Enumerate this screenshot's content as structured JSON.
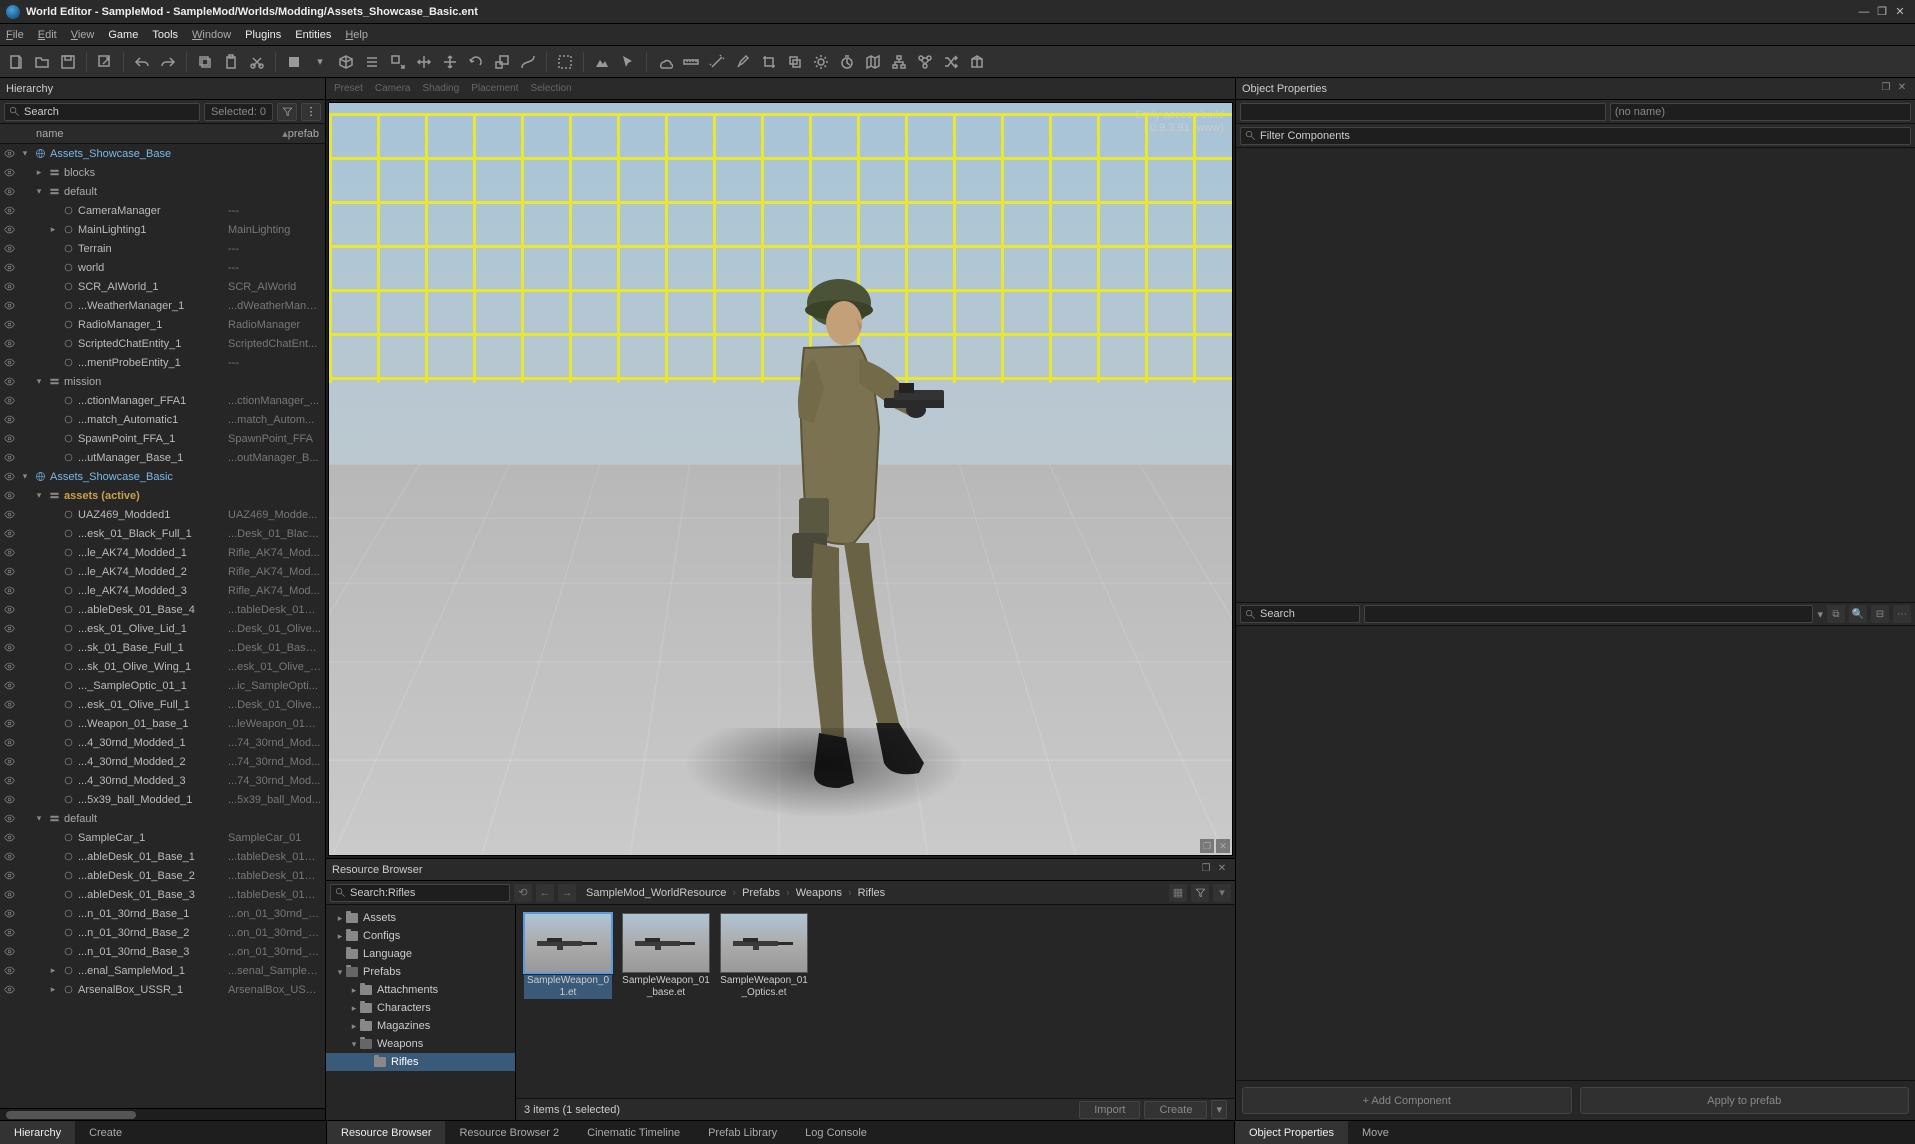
{
  "title": "World Editor - SampleMod - SampleMod/Worlds/Modding/Assets_Showcase_Basic.ent",
  "menus": [
    "File",
    "Edit",
    "View",
    "Game",
    "Tools",
    "Window",
    "Plugins",
    "Entities",
    "Help"
  ],
  "vp_tabs": [
    "Preset",
    "Camera",
    "Shading",
    "Placement",
    "Selection"
  ],
  "watermark": {
    "l1": "Early access build",
    "l2": "0.9.3.91 (www)"
  },
  "hierarchy": {
    "title": "Hierarchy",
    "search_ph": "Search",
    "selected": "Selected: 0",
    "head_name": "name",
    "head_prefab": "prefab",
    "tabs": [
      "Hierarchy",
      "Create"
    ],
    "rows": [
      {
        "d": 0,
        "tw": "▾",
        "ico": "world",
        "nm": "Assets_Showcase_Base",
        "pf": "",
        "hl": 1
      },
      {
        "d": 1,
        "tw": "▸",
        "ico": "layer",
        "nm": "blocks",
        "pf": "",
        "grp": 1
      },
      {
        "d": 1,
        "tw": "▾",
        "ico": "layer",
        "nm": "default",
        "pf": "",
        "grp": 1
      },
      {
        "d": 2,
        "tw": "",
        "ico": "ent",
        "nm": "CameraManager",
        "pf": "---"
      },
      {
        "d": 2,
        "tw": "▸",
        "ico": "ent",
        "nm": "MainLighting1",
        "pf": "MainLighting"
      },
      {
        "d": 2,
        "tw": "",
        "ico": "ent",
        "nm": "Terrain",
        "pf": "---"
      },
      {
        "d": 2,
        "tw": "",
        "ico": "ent",
        "nm": "world",
        "pf": "---"
      },
      {
        "d": 2,
        "tw": "",
        "ico": "ent",
        "nm": "SCR_AIWorld_1",
        "pf": "SCR_AIWorld"
      },
      {
        "d": 2,
        "tw": "",
        "ico": "ent",
        "nm": "...WeatherManager_1",
        "pf": "...dWeatherMana..."
      },
      {
        "d": 2,
        "tw": "",
        "ico": "ent",
        "nm": "RadioManager_1",
        "pf": "RadioManager"
      },
      {
        "d": 2,
        "tw": "",
        "ico": "ent",
        "nm": "ScriptedChatEntity_1",
        "pf": "ScriptedChatEnt..."
      },
      {
        "d": 2,
        "tw": "",
        "ico": "ent",
        "nm": "...mentProbeEntity_1",
        "pf": "---"
      },
      {
        "d": 1,
        "tw": "▾",
        "ico": "layer",
        "nm": "mission",
        "pf": "",
        "grp": 1
      },
      {
        "d": 2,
        "tw": "",
        "ico": "ent",
        "nm": "...ctionManager_FFA1",
        "pf": "...ctionManager_..."
      },
      {
        "d": 2,
        "tw": "",
        "ico": "ent",
        "nm": "...match_Automatic1",
        "pf": "...match_Autom..."
      },
      {
        "d": 2,
        "tw": "",
        "ico": "ent",
        "nm": "SpawnPoint_FFA_1",
        "pf": "SpawnPoint_FFA"
      },
      {
        "d": 2,
        "tw": "",
        "ico": "ent",
        "nm": "...utManager_Base_1",
        "pf": "...outManager_B..."
      },
      {
        "d": 0,
        "tw": "▾",
        "ico": "world",
        "nm": "Assets_Showcase_Basic",
        "pf": "",
        "hl": 1
      },
      {
        "d": 1,
        "tw": "▾",
        "ico": "layer",
        "nm": "assets (active)",
        "pf": "",
        "active": 1
      },
      {
        "d": 2,
        "tw": "",
        "ico": "ent",
        "nm": "UAZ469_Modded1",
        "pf": "UAZ469_Modde..."
      },
      {
        "d": 2,
        "tw": "",
        "ico": "ent",
        "nm": "...esk_01_Black_Full_1",
        "pf": "...Desk_01_Black..."
      },
      {
        "d": 2,
        "tw": "",
        "ico": "ent",
        "nm": "...le_AK74_Modded_1",
        "pf": "Rifle_AK74_Mod..."
      },
      {
        "d": 2,
        "tw": "",
        "ico": "ent",
        "nm": "...le_AK74_Modded_2",
        "pf": "Rifle_AK74_Mod..."
      },
      {
        "d": 2,
        "tw": "",
        "ico": "ent",
        "nm": "...le_AK74_Modded_3",
        "pf": "Rifle_AK74_Mod..."
      },
      {
        "d": 2,
        "tw": "",
        "ico": "ent",
        "nm": "...ableDesk_01_Base_4",
        "pf": "...tableDesk_01_B..."
      },
      {
        "d": 2,
        "tw": "",
        "ico": "ent",
        "nm": "...esk_01_Olive_Lid_1",
        "pf": "...Desk_01_Olive..."
      },
      {
        "d": 2,
        "tw": "",
        "ico": "ent",
        "nm": "...sk_01_Base_Full_1",
        "pf": "...Desk_01_Base_..."
      },
      {
        "d": 2,
        "tw": "",
        "ico": "ent",
        "nm": "...sk_01_Olive_Wing_1",
        "pf": "...esk_01_Olive_W..."
      },
      {
        "d": 2,
        "tw": "",
        "ico": "ent",
        "nm": "..._SampleOptic_01_1",
        "pf": "...ic_SampleOpti..."
      },
      {
        "d": 2,
        "tw": "",
        "ico": "ent",
        "nm": "...esk_01_Olive_Full_1",
        "pf": "...Desk_01_Olive..."
      },
      {
        "d": 2,
        "tw": "",
        "ico": "ent",
        "nm": "...Weapon_01_base_1",
        "pf": "...leWeapon_01_b..."
      },
      {
        "d": 2,
        "tw": "",
        "ico": "ent",
        "nm": "...4_30rnd_Modded_1",
        "pf": "...74_30rnd_Mod..."
      },
      {
        "d": 2,
        "tw": "",
        "ico": "ent",
        "nm": "...4_30rnd_Modded_2",
        "pf": "...74_30rnd_Mod..."
      },
      {
        "d": 2,
        "tw": "",
        "ico": "ent",
        "nm": "...4_30rnd_Modded_3",
        "pf": "...74_30rnd_Mod..."
      },
      {
        "d": 2,
        "tw": "",
        "ico": "ent",
        "nm": "...5x39_ball_Modded_1",
        "pf": "...5x39_ball_Mod..."
      },
      {
        "d": 1,
        "tw": "▾",
        "ico": "layer",
        "nm": "default",
        "pf": "",
        "grp": 1
      },
      {
        "d": 2,
        "tw": "",
        "ico": "ent",
        "nm": "SampleCar_1",
        "pf": "SampleCar_01"
      },
      {
        "d": 2,
        "tw": "",
        "ico": "ent",
        "nm": "...ableDesk_01_Base_1",
        "pf": "...tableDesk_01_B..."
      },
      {
        "d": 2,
        "tw": "",
        "ico": "ent",
        "nm": "...ableDesk_01_Base_2",
        "pf": "...tableDesk_01_B..."
      },
      {
        "d": 2,
        "tw": "",
        "ico": "ent",
        "nm": "...ableDesk_01_Base_3",
        "pf": "...tableDesk_01_B..."
      },
      {
        "d": 2,
        "tw": "",
        "ico": "ent",
        "nm": "...n_01_30rnd_Base_1",
        "pf": "...on_01_30rnd_B..."
      },
      {
        "d": 2,
        "tw": "",
        "ico": "ent",
        "nm": "...n_01_30rnd_Base_2",
        "pf": "...on_01_30rnd_B..."
      },
      {
        "d": 2,
        "tw": "",
        "ico": "ent",
        "nm": "...n_01_30rnd_Base_3",
        "pf": "...on_01_30rnd_B..."
      },
      {
        "d": 2,
        "tw": "▸",
        "ico": "ent",
        "nm": "...enal_SampleMod_1",
        "pf": "...senal_SampleM..."
      },
      {
        "d": 2,
        "tw": "▸",
        "ico": "ent",
        "nm": "ArsenalBox_USSR_1",
        "pf": "ArsenalBox_USSR..."
      }
    ]
  },
  "rb": {
    "title": "Resource Browser",
    "search_val": "Search:Rifles",
    "crumbs": [
      "SampleMod_WorldResource",
      "Prefabs",
      "Weapons",
      "Rifles"
    ],
    "tree": [
      {
        "d": 0,
        "tw": "▸",
        "nm": "Assets"
      },
      {
        "d": 0,
        "tw": "▸",
        "nm": "Configs"
      },
      {
        "d": 0,
        "tw": "",
        "nm": "Language"
      },
      {
        "d": 0,
        "tw": "▾",
        "nm": "Prefabs",
        "open": 1
      },
      {
        "d": 1,
        "tw": "▸",
        "nm": "Attachments"
      },
      {
        "d": 1,
        "tw": "▸",
        "nm": "Characters"
      },
      {
        "d": 1,
        "tw": "▸",
        "nm": "Magazines"
      },
      {
        "d": 1,
        "tw": "▾",
        "nm": "Weapons",
        "open": 1
      },
      {
        "d": 2,
        "tw": "",
        "nm": "Rifles",
        "sel": 1
      }
    ],
    "items": [
      {
        "nm": "SampleWeapon_01.et",
        "sel": 1
      },
      {
        "nm": "SampleWeapon_01_base.et"
      },
      {
        "nm": "SampleWeapon_01_Optics.et"
      }
    ],
    "status": "3 items (1 selected)",
    "btn_import": "Import",
    "btn_create": "Create"
  },
  "props": {
    "title": "Object Properties",
    "noname": "(no name)",
    "filter_ph": "Filter Components",
    "search_ph": "Search",
    "add": "+ Add Component",
    "apply": "Apply to prefab",
    "tabs": [
      "Object Properties",
      "Move"
    ]
  },
  "bottom_tabs_center": [
    "Resource Browser",
    "Resource Browser 2",
    "Cinematic Timeline",
    "Prefab Library",
    "Log Console"
  ]
}
